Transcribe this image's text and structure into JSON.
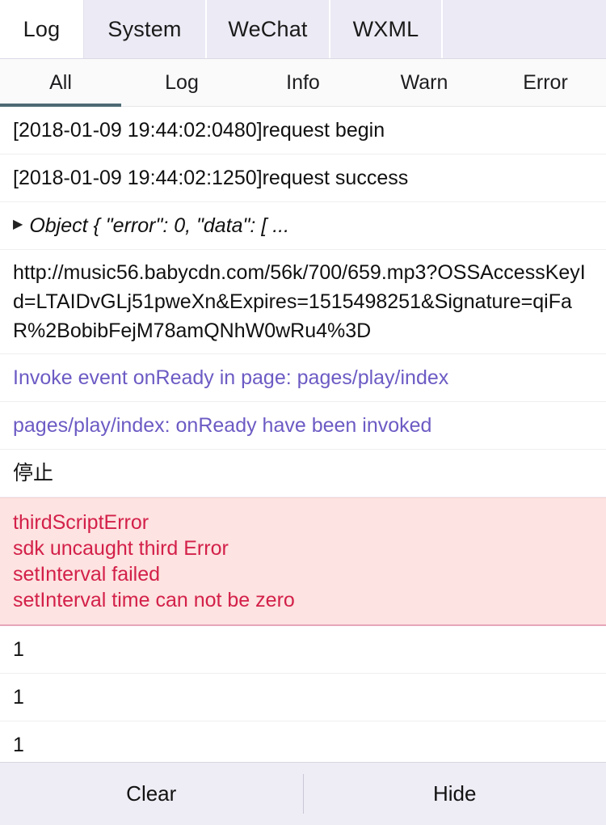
{
  "panel_tabs": [
    {
      "label": "Log",
      "active": true
    },
    {
      "label": "System",
      "active": false
    },
    {
      "label": "WeChat",
      "active": false
    },
    {
      "label": "WXML",
      "active": false
    }
  ],
  "filter_tabs": [
    {
      "label": "All",
      "active": true
    },
    {
      "label": "Log",
      "active": false
    },
    {
      "label": "Info",
      "active": false
    },
    {
      "label": "Warn",
      "active": false
    },
    {
      "label": "Error",
      "active": false
    }
  ],
  "log_rows": [
    {
      "kind": "plain",
      "text": "[2018-01-09 19:44:02:0480]request begin"
    },
    {
      "kind": "plain",
      "text": "[2018-01-09 19:44:02:1250]request success"
    },
    {
      "kind": "object",
      "icon": "disclosure-triangle-right-icon",
      "text": "Object { \"error\": 0, \"data\": [ ..."
    },
    {
      "kind": "url",
      "text": "http://music56.babycdn.com/56k/700/659.mp3?OSSAccessKeyId=LTAIDvGLj51pweXn&Expires=1515498251&Signature=qiFaR%2BobibFejM78amQNhW0wRu4%3D"
    },
    {
      "kind": "invoke",
      "text": "Invoke event onReady in page: pages/play/index"
    },
    {
      "kind": "invoke",
      "text": "pages/play/index: onReady have been invoked"
    },
    {
      "kind": "cn",
      "text": "停止"
    },
    {
      "kind": "error",
      "lines": [
        "thirdScriptError",
        "sdk uncaught third Error",
        "setInterval failed",
        "setInterval time can not be zero"
      ]
    },
    {
      "kind": "plain",
      "text": "1"
    },
    {
      "kind": "plain",
      "text": "1"
    },
    {
      "kind": "plain",
      "text": "1"
    }
  ],
  "footer": {
    "clear_label": "Clear",
    "hide_label": "Hide"
  },
  "colors": {
    "active_tab_underline": "#4c6a74",
    "invoke_text": "#6c5bc4",
    "error_text": "#d32049",
    "error_background": "#fde3e1",
    "tab_background": "#eceaf4",
    "footer_background": "#eeedf5"
  }
}
